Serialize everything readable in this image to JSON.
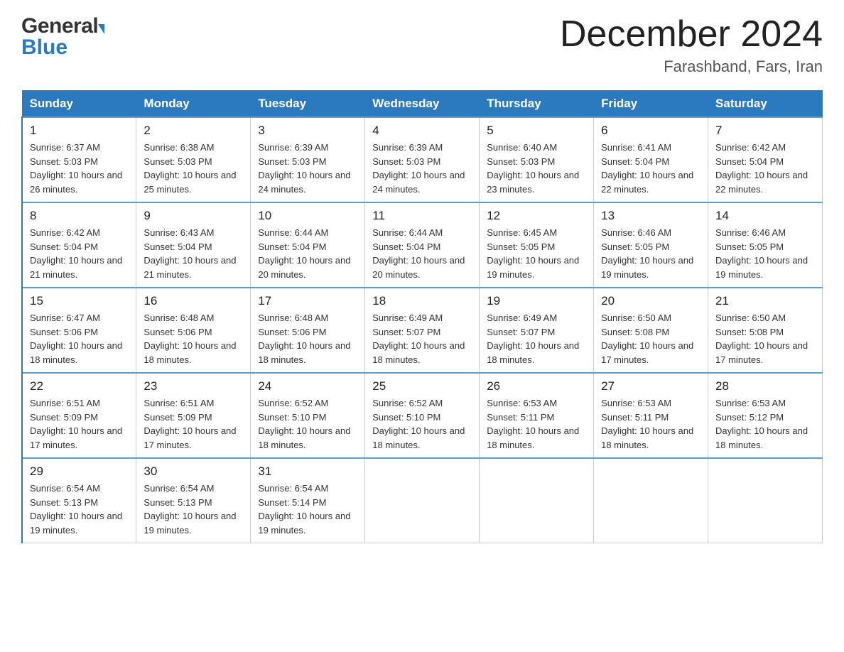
{
  "header": {
    "logo_general": "General",
    "logo_blue": "Blue",
    "month_title": "December 2024",
    "location": "Farashband, Fars, Iran"
  },
  "calendar": {
    "days_of_week": [
      "Sunday",
      "Monday",
      "Tuesday",
      "Wednesday",
      "Thursday",
      "Friday",
      "Saturday"
    ],
    "weeks": [
      [
        {
          "day": "1",
          "sunrise": "6:37 AM",
          "sunset": "5:03 PM",
          "daylight": "10 hours and 26 minutes."
        },
        {
          "day": "2",
          "sunrise": "6:38 AM",
          "sunset": "5:03 PM",
          "daylight": "10 hours and 25 minutes."
        },
        {
          "day": "3",
          "sunrise": "6:39 AM",
          "sunset": "5:03 PM",
          "daylight": "10 hours and 24 minutes."
        },
        {
          "day": "4",
          "sunrise": "6:39 AM",
          "sunset": "5:03 PM",
          "daylight": "10 hours and 24 minutes."
        },
        {
          "day": "5",
          "sunrise": "6:40 AM",
          "sunset": "5:03 PM",
          "daylight": "10 hours and 23 minutes."
        },
        {
          "day": "6",
          "sunrise": "6:41 AM",
          "sunset": "5:04 PM",
          "daylight": "10 hours and 22 minutes."
        },
        {
          "day": "7",
          "sunrise": "6:42 AM",
          "sunset": "5:04 PM",
          "daylight": "10 hours and 22 minutes."
        }
      ],
      [
        {
          "day": "8",
          "sunrise": "6:42 AM",
          "sunset": "5:04 PM",
          "daylight": "10 hours and 21 minutes."
        },
        {
          "day": "9",
          "sunrise": "6:43 AM",
          "sunset": "5:04 PM",
          "daylight": "10 hours and 21 minutes."
        },
        {
          "day": "10",
          "sunrise": "6:44 AM",
          "sunset": "5:04 PM",
          "daylight": "10 hours and 20 minutes."
        },
        {
          "day": "11",
          "sunrise": "6:44 AM",
          "sunset": "5:04 PM",
          "daylight": "10 hours and 20 minutes."
        },
        {
          "day": "12",
          "sunrise": "6:45 AM",
          "sunset": "5:05 PM",
          "daylight": "10 hours and 19 minutes."
        },
        {
          "day": "13",
          "sunrise": "6:46 AM",
          "sunset": "5:05 PM",
          "daylight": "10 hours and 19 minutes."
        },
        {
          "day": "14",
          "sunrise": "6:46 AM",
          "sunset": "5:05 PM",
          "daylight": "10 hours and 19 minutes."
        }
      ],
      [
        {
          "day": "15",
          "sunrise": "6:47 AM",
          "sunset": "5:06 PM",
          "daylight": "10 hours and 18 minutes."
        },
        {
          "day": "16",
          "sunrise": "6:48 AM",
          "sunset": "5:06 PM",
          "daylight": "10 hours and 18 minutes."
        },
        {
          "day": "17",
          "sunrise": "6:48 AM",
          "sunset": "5:06 PM",
          "daylight": "10 hours and 18 minutes."
        },
        {
          "day": "18",
          "sunrise": "6:49 AM",
          "sunset": "5:07 PM",
          "daylight": "10 hours and 18 minutes."
        },
        {
          "day": "19",
          "sunrise": "6:49 AM",
          "sunset": "5:07 PM",
          "daylight": "10 hours and 18 minutes."
        },
        {
          "day": "20",
          "sunrise": "6:50 AM",
          "sunset": "5:08 PM",
          "daylight": "10 hours and 17 minutes."
        },
        {
          "day": "21",
          "sunrise": "6:50 AM",
          "sunset": "5:08 PM",
          "daylight": "10 hours and 17 minutes."
        }
      ],
      [
        {
          "day": "22",
          "sunrise": "6:51 AM",
          "sunset": "5:09 PM",
          "daylight": "10 hours and 17 minutes."
        },
        {
          "day": "23",
          "sunrise": "6:51 AM",
          "sunset": "5:09 PM",
          "daylight": "10 hours and 17 minutes."
        },
        {
          "day": "24",
          "sunrise": "6:52 AM",
          "sunset": "5:10 PM",
          "daylight": "10 hours and 18 minutes."
        },
        {
          "day": "25",
          "sunrise": "6:52 AM",
          "sunset": "5:10 PM",
          "daylight": "10 hours and 18 minutes."
        },
        {
          "day": "26",
          "sunrise": "6:53 AM",
          "sunset": "5:11 PM",
          "daylight": "10 hours and 18 minutes."
        },
        {
          "day": "27",
          "sunrise": "6:53 AM",
          "sunset": "5:11 PM",
          "daylight": "10 hours and 18 minutes."
        },
        {
          "day": "28",
          "sunrise": "6:53 AM",
          "sunset": "5:12 PM",
          "daylight": "10 hours and 18 minutes."
        }
      ],
      [
        {
          "day": "29",
          "sunrise": "6:54 AM",
          "sunset": "5:13 PM",
          "daylight": "10 hours and 19 minutes."
        },
        {
          "day": "30",
          "sunrise": "6:54 AM",
          "sunset": "5:13 PM",
          "daylight": "10 hours and 19 minutes."
        },
        {
          "day": "31",
          "sunrise": "6:54 AM",
          "sunset": "5:14 PM",
          "daylight": "10 hours and 19 minutes."
        },
        {
          "day": "",
          "sunrise": "",
          "sunset": "",
          "daylight": ""
        },
        {
          "day": "",
          "sunrise": "",
          "sunset": "",
          "daylight": ""
        },
        {
          "day": "",
          "sunrise": "",
          "sunset": "",
          "daylight": ""
        },
        {
          "day": "",
          "sunrise": "",
          "sunset": "",
          "daylight": ""
        }
      ]
    ]
  }
}
